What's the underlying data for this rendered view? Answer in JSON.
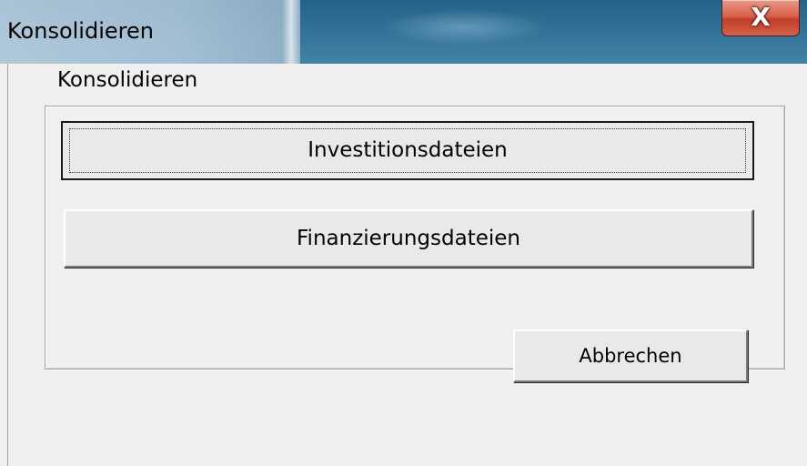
{
  "window": {
    "title": "Konsolidieren",
    "close_glyph": "X",
    "close_icon": "close-icon"
  },
  "group": {
    "caption": "Konsolidieren"
  },
  "buttons": {
    "invest_label": "Investitionsdateien",
    "finanz_label": "Finanzierungsdateien",
    "cancel_label": "Abbrechen"
  },
  "colors": {
    "dialog_background": "#f0f0f0",
    "close_button": "#c94530",
    "titlebar_glass": "#2c6f95"
  }
}
